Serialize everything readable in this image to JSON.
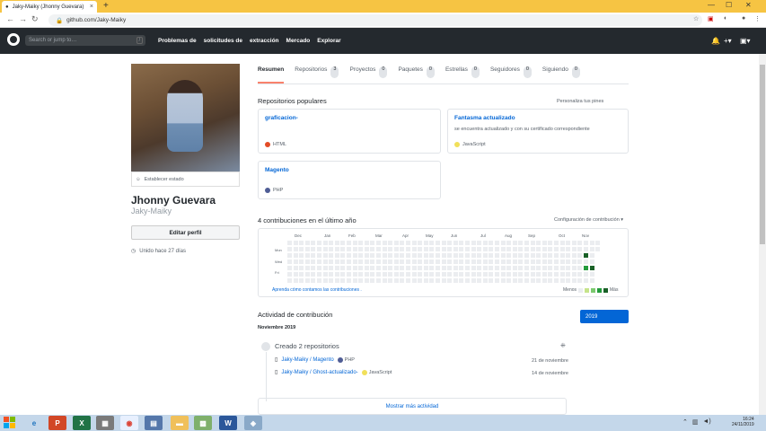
{
  "browser": {
    "tab_title": "Jaky-Maiky (Jhonny Guevara)",
    "url": "github.com/Jaky-Maiky"
  },
  "header": {
    "search_placeholder": "Search or jump to…",
    "search_shortcut": "/",
    "nav": [
      "Problemas de",
      "solicitudes de",
      "extracción",
      "Mercado",
      "Explorar"
    ]
  },
  "profile": {
    "status_label": "Establecer estado",
    "name": "Jhonny Guevara",
    "username": "Jaky-Maiky",
    "edit_label": "Editar perfil",
    "joined": "Unido hace 27 días"
  },
  "tabs": [
    {
      "label": "Resumen",
      "count": null,
      "selected": true
    },
    {
      "label": "Repositorios",
      "count": "3"
    },
    {
      "label": "Proyectos",
      "count": "0"
    },
    {
      "label": "Paquetes",
      "count": "0"
    },
    {
      "label": "Estrellas",
      "count": "0"
    },
    {
      "label": "Seguidores",
      "count": "0"
    },
    {
      "label": "Siguiendo",
      "count": "0"
    }
  ],
  "popular": {
    "title": "Repositorios populares",
    "customize": "Personaliza tus pines",
    "repos": [
      {
        "name": "graficacion-",
        "description": "",
        "language": "HTML",
        "color": "#e34c26"
      },
      {
        "name": "Fantasma actualizado",
        "description": "se encuentra actualizado y con su certificado correspondiente",
        "language": "JavaScript",
        "color": "#f1e05a"
      },
      {
        "name": "Magento",
        "description": "",
        "language": "PHP",
        "color": "#4F5D95"
      }
    ]
  },
  "contributions": {
    "title": "4 contribuciones en el último año",
    "settings": "Configuración de contribución",
    "months": [
      "Dec",
      "Jan",
      "Feb",
      "Mar",
      "Apr",
      "May",
      "Jun",
      "Jul",
      "Aug",
      "Sep",
      "Oct",
      "Nov"
    ],
    "day_labels": [
      "Mon",
      "Wed",
      "Fri"
    ],
    "learn": "Aprenda cómo contamos las contribuciones .",
    "less": "Menos",
    "more": "Más",
    "colors": [
      "#ebedf0",
      "#c6e48b",
      "#7bc96f",
      "#239a3b",
      "#196127"
    ]
  },
  "activity": {
    "title": "Actividad de contribución",
    "year": "2019",
    "month": "Noviembre 2019",
    "created": "Creado 2 repositorios",
    "items": [
      {
        "name": "Jaky-Maiky / Magento",
        "language": "PHP",
        "color": "#4F5D95",
        "date": "21 de noviembre"
      },
      {
        "name": "Jaky-Maiky / Ghost-actualizado-",
        "language": "JavaScript",
        "color": "#f1e05a",
        "date": "14 de noviembre"
      }
    ],
    "show_more": "Mostrar más actividad"
  },
  "taskbar": {
    "time": "16:24",
    "date": "24/11/2019"
  }
}
